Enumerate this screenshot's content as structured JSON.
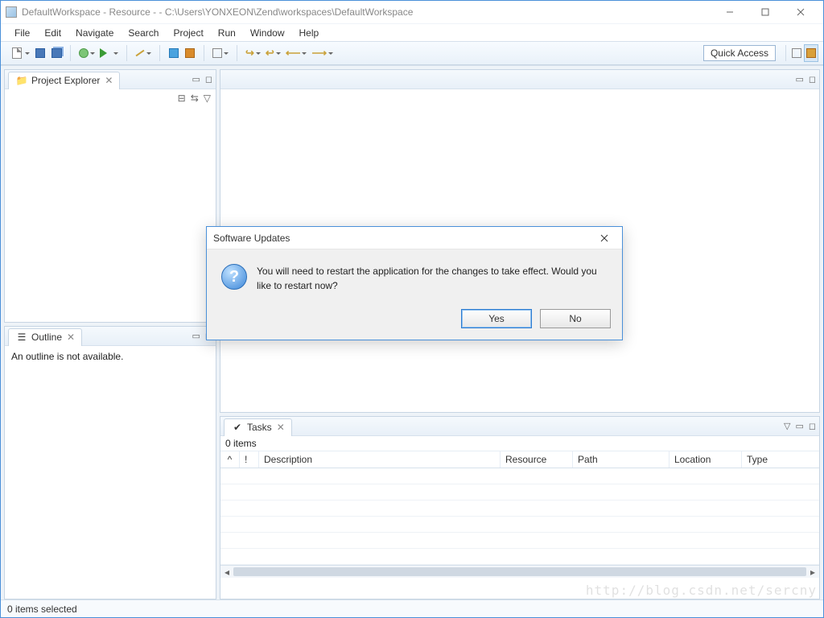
{
  "window": {
    "title": "DefaultWorkspace - Resource -  - C:\\Users\\YONXEON\\Zend\\workspaces\\DefaultWorkspace"
  },
  "menu": {
    "items": [
      "File",
      "Edit",
      "Navigate",
      "Search",
      "Project",
      "Run",
      "Window",
      "Help"
    ]
  },
  "toolbar": {
    "quick_access": "Quick Access"
  },
  "project_explorer": {
    "tab": "Project Explorer"
  },
  "outline": {
    "tab": "Outline",
    "empty": "An outline is not available."
  },
  "tasks": {
    "tab": "Tasks",
    "count": "0 items",
    "columns": [
      "",
      "!",
      "Description",
      "Resource",
      "Path",
      "Location",
      "Type"
    ]
  },
  "status": {
    "text": "0 items selected"
  },
  "dialog": {
    "title": "Software Updates",
    "message": "You will need to restart the application for the changes to take effect. Would you like to restart now?",
    "yes": "Yes",
    "no": "No"
  },
  "watermark": "http://blog.csdn.net/sercny"
}
